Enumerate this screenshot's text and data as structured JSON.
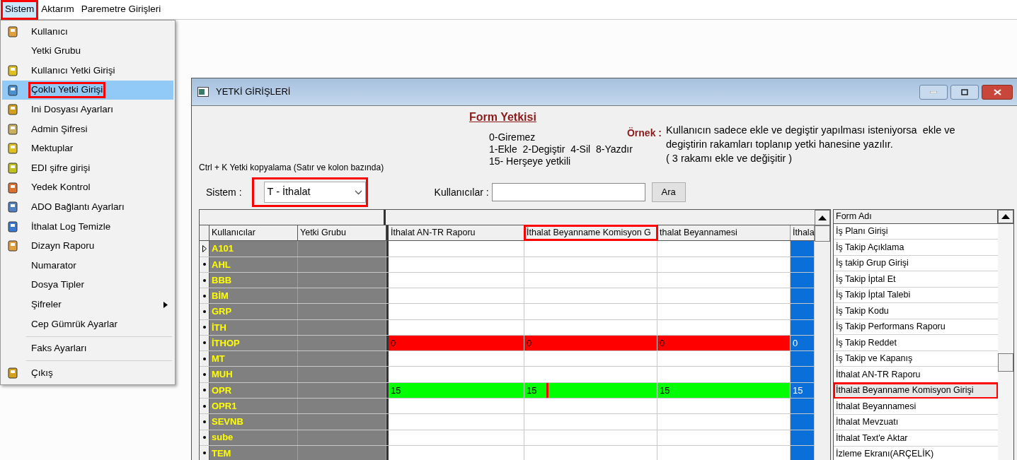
{
  "menubar": [
    {
      "label": "Sistem",
      "selected": true,
      "annotated": true
    },
    {
      "label": "Aktarım",
      "selected": false,
      "annotated": false
    },
    {
      "label": "Paremetre Girişleri",
      "selected": false,
      "annotated": false
    }
  ],
  "menu": [
    {
      "kind": "item",
      "label": "Kullanıcı",
      "icon": true,
      "selected": false,
      "annotated": false,
      "submenu": false
    },
    {
      "kind": "item",
      "label": "Yetki Grubu",
      "icon": false,
      "selected": false,
      "annotated": false,
      "submenu": false
    },
    {
      "kind": "item",
      "label": "Kullanıcı Yetki Girişi",
      "icon": true,
      "selected": false,
      "annotated": false,
      "submenu": false
    },
    {
      "kind": "item",
      "label": "Çoklu Yetki Girişi",
      "icon": true,
      "selected": true,
      "annotated": true,
      "submenu": false
    },
    {
      "kind": "item",
      "label": "Ini Dosyası  Ayarları",
      "icon": true,
      "selected": false,
      "annotated": false,
      "submenu": false
    },
    {
      "kind": "item",
      "label": "Admin Şifresi",
      "icon": true,
      "selected": false,
      "annotated": false,
      "submenu": false
    },
    {
      "kind": "item",
      "label": "Mektuplar",
      "icon": true,
      "selected": false,
      "annotated": false,
      "submenu": false
    },
    {
      "kind": "item",
      "label": "EDI şifre girişi",
      "icon": true,
      "selected": false,
      "annotated": false,
      "submenu": false
    },
    {
      "kind": "item",
      "label": "Yedek Kontrol",
      "icon": true,
      "selected": false,
      "annotated": false,
      "submenu": false
    },
    {
      "kind": "item",
      "label": "ADO Bağlantı Ayarları",
      "icon": true,
      "selected": false,
      "annotated": false,
      "submenu": false
    },
    {
      "kind": "item",
      "label": "İthalat Log Temizle",
      "icon": true,
      "selected": false,
      "annotated": false,
      "submenu": false
    },
    {
      "kind": "item",
      "label": "Dizayn Raporu",
      "icon": true,
      "selected": false,
      "annotated": false,
      "submenu": false
    },
    {
      "kind": "item",
      "label": "Numarator",
      "icon": false,
      "selected": false,
      "annotated": false,
      "submenu": false
    },
    {
      "kind": "item",
      "label": "Dosya Tipler",
      "icon": false,
      "selected": false,
      "annotated": false,
      "submenu": false
    },
    {
      "kind": "item",
      "label": "Şifreler",
      "icon": false,
      "selected": false,
      "annotated": false,
      "submenu": true
    },
    {
      "kind": "item",
      "label": "Cep Gümrük Ayarlar",
      "icon": false,
      "selected": false,
      "annotated": false,
      "submenu": false
    },
    {
      "kind": "separator"
    },
    {
      "kind": "item",
      "label": "Faks Ayarları",
      "icon": false,
      "selected": false,
      "annotated": false,
      "submenu": false
    },
    {
      "kind": "separator"
    },
    {
      "kind": "item",
      "label": "Çıkış",
      "icon": true,
      "selected": false,
      "annotated": false,
      "submenu": false
    }
  ],
  "window": {
    "title": "YETKİ GİRİŞLERİ",
    "heading": "Form Yetkisi",
    "copy_hint": "Ctrl + K Yetki kopyalama (Satır ve kolon bazında)",
    "legend": [
      "0-Giremez",
      "1-Ekle  2-Degiştir  4-Sil  8-Yazdır",
      "15- Herşeye yetkili"
    ],
    "example_label": "Örnek :",
    "example_text": [
      "Kullanıcın sadece ekle ve degiştir yapılması isteniyorsa  ekle ve",
      "degiştirin rakamları toplanıp yetki hanesine yazılır.",
      "( 3 rakamı ekle ve değişitir )"
    ],
    "system_label": "Sistem :",
    "system_value": "T - İthalat",
    "system_annotated": true,
    "users_label": "Kullanıcılar :",
    "search_button": "Ara"
  },
  "grid": {
    "fixed_columns": [
      "Kullanıcılar",
      "Yetki Grubu"
    ],
    "columns": [
      {
        "label": "İthalat AN-TR Raporu",
        "selected": false,
        "annotated": false
      },
      {
        "label": "İthalat Beyanname Komisyon G",
        "selected": false,
        "annotated": true
      },
      {
        "label": "thalat Beyannamesi",
        "selected": false,
        "annotated": false
      },
      {
        "label": "İthala",
        "selected": true,
        "annotated": false
      }
    ],
    "rows": [
      {
        "user": "A101",
        "current": true
      },
      {
        "user": "AHL",
        "current": false
      },
      {
        "user": "BBB",
        "current": false
      },
      {
        "user": "BİM",
        "current": false
      },
      {
        "user": "GRP",
        "current": false
      },
      {
        "user": "İTH",
        "current": false
      },
      {
        "user": "İTHOP",
        "current": false,
        "color": "#ff0000",
        "cells": [
          {
            "value": "0",
            "annotated": false
          },
          {
            "value": "0",
            "annotated": false
          },
          {
            "value": "0",
            "annotated": false
          },
          {
            "value": "0",
            "annotated": false
          }
        ]
      },
      {
        "user": "MT",
        "current": false
      },
      {
        "user": "MUH",
        "current": false
      },
      {
        "user": "OPR",
        "current": false,
        "color": "#00ff00",
        "cells": [
          {
            "value": "15",
            "annotated": false
          },
          {
            "value": "15",
            "annotated": true
          },
          {
            "value": "15",
            "annotated": false
          },
          {
            "value": "15",
            "annotated": false
          }
        ]
      },
      {
        "user": "OPR1",
        "current": false
      },
      {
        "user": "SEVNB",
        "current": false
      },
      {
        "user": "sube",
        "current": false
      },
      {
        "user": "TEM",
        "current": false
      }
    ]
  },
  "forms": {
    "heading": "Form Adı",
    "items": [
      {
        "label": "İş Planı Girişi",
        "selected": false,
        "annotated": false
      },
      {
        "label": "İş Takip Açıklama",
        "selected": false,
        "annotated": false
      },
      {
        "label": "İş takip Grup Girişi",
        "selected": false,
        "annotated": false
      },
      {
        "label": "İş Takip İptal Et",
        "selected": false,
        "annotated": false
      },
      {
        "label": "İş Takip İptal Talebi",
        "selected": false,
        "annotated": false
      },
      {
        "label": "İş Takip Kodu",
        "selected": false,
        "annotated": false
      },
      {
        "label": "İş Takip Performans Raporu",
        "selected": false,
        "annotated": false
      },
      {
        "label": "İş Takip Reddet",
        "selected": false,
        "annotated": false
      },
      {
        "label": "İş Takip ve Kapanış",
        "selected": false,
        "annotated": false
      },
      {
        "label": "İthalat AN-TR Raporu",
        "selected": false,
        "annotated": false
      },
      {
        "label": "İthalat Beyanname Komisyon Girişi",
        "selected": true,
        "annotated": true
      },
      {
        "label": "İthalat Beyannamesi",
        "selected": false,
        "annotated": false
      },
      {
        "label": "İthalat Mevzuatı",
        "selected": false,
        "annotated": false
      },
      {
        "label": "İthalat Text'e Aktar",
        "selected": false,
        "annotated": false
      },
      {
        "label": "İzleme Ekranı(ARÇELİK)",
        "selected": false,
        "annotated": false
      }
    ]
  }
}
